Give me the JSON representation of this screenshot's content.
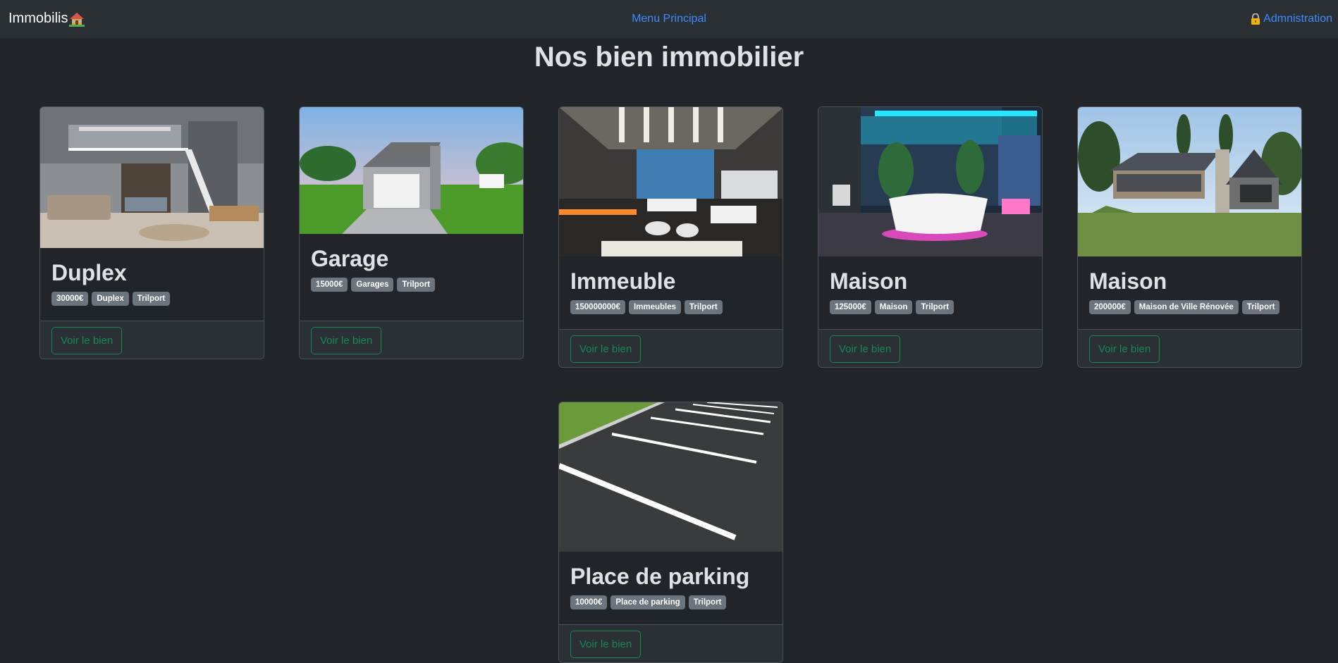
{
  "navbar": {
    "brand": "Immobilis",
    "brand_icon": "house-icon",
    "center_link": "Menu Principal",
    "admin_link": "Admnistration",
    "admin_icon": "lock-icon",
    "link_color": "#3d8bfd"
  },
  "page_title": "Nos bien immobilier",
  "cards": [
    {
      "title": "Duplex",
      "price": "30000€",
      "type": "Duplex",
      "city": "Trilport",
      "button": "Voir le bien",
      "image": "duplex-interior-image"
    },
    {
      "title": "Garage",
      "price": "15000€",
      "type": "Garages",
      "city": "Trilport",
      "button": "Voir le bien",
      "image": "garage-image"
    },
    {
      "title": "Immeuble",
      "price": "150000000€",
      "type": "Immeubles",
      "city": "Trilport",
      "button": "Voir le bien",
      "image": "lounge-interior-image"
    },
    {
      "title": "Maison",
      "price": "125000€",
      "type": "Maison",
      "city": "Trilport",
      "button": "Voir le bien",
      "image": "bathroom-neon-image"
    },
    {
      "title": "Maison",
      "price": "200000€",
      "type": "Maison de Ville Rénovée",
      "city": "Trilport",
      "button": "Voir le bien",
      "image": "modern-house-image"
    },
    {
      "title": "Place de parking",
      "price": "10000€",
      "type": "Place de parking",
      "city": "Trilport",
      "button": "Voir le bien",
      "image": "parking-lot-image"
    }
  ],
  "colors": {
    "background": "#212529",
    "navbar": "#2b3035",
    "badge": "#6c757d",
    "button_outline": "#198754"
  }
}
